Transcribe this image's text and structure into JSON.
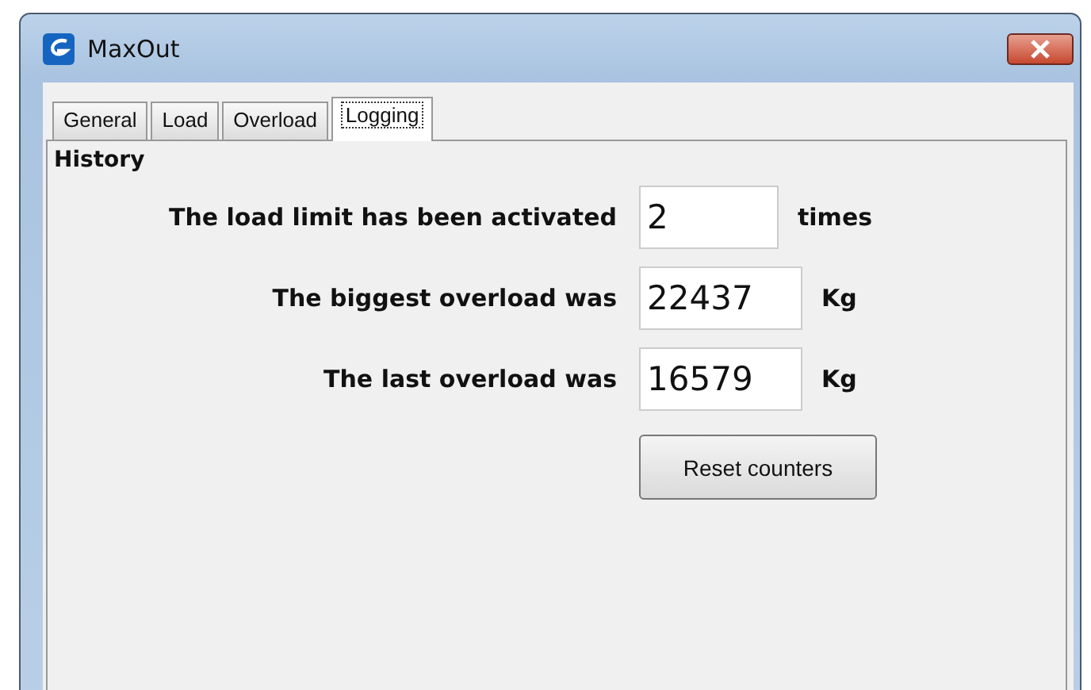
{
  "window": {
    "title": "MaxOut"
  },
  "tabs": [
    {
      "label": "General",
      "selected": false
    },
    {
      "label": "Load",
      "selected": false
    },
    {
      "label": "Overload",
      "selected": false
    },
    {
      "label": "Logging",
      "selected": true
    }
  ],
  "history": {
    "heading": "History",
    "rows": [
      {
        "label": "The load limit has been activated",
        "value": "2",
        "unit": "times"
      },
      {
        "label": "The biggest overload was",
        "value": "22437",
        "unit": "Kg"
      },
      {
        "label": "The last overload was",
        "value": "16579",
        "unit": "Kg"
      }
    ],
    "button": "Reset counters"
  }
}
